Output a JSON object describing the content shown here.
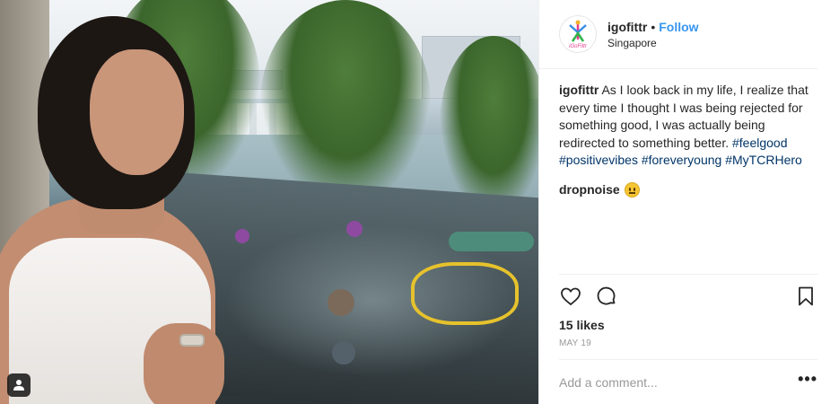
{
  "post": {
    "username": "igofittr",
    "separator": "•",
    "follow_label": "Follow",
    "location": "Singapore",
    "avatar_logo_text": "iGoFittr"
  },
  "caption": {
    "username": "igofittr",
    "text": "As I look back in my life, I realize that every time I thought I was being rejected for something good, I was actually being redirected to something better.",
    "hashtags": [
      "#feelgood",
      "#positivevibes",
      "#foreveryoung",
      "#MyTCRHero"
    ]
  },
  "comments": [
    {
      "username": "dropnoise",
      "emoji": "grinning-face-emoji"
    }
  ],
  "engagement": {
    "likes": "15 likes",
    "date": "MAY 19"
  },
  "comment_input": {
    "placeholder": "Add a comment...",
    "more_label": "•••"
  },
  "icons": {
    "like": "heart-icon",
    "comment": "comment-bubble-icon",
    "save": "bookmark-icon",
    "user_tag": "person-tag-icon"
  }
}
